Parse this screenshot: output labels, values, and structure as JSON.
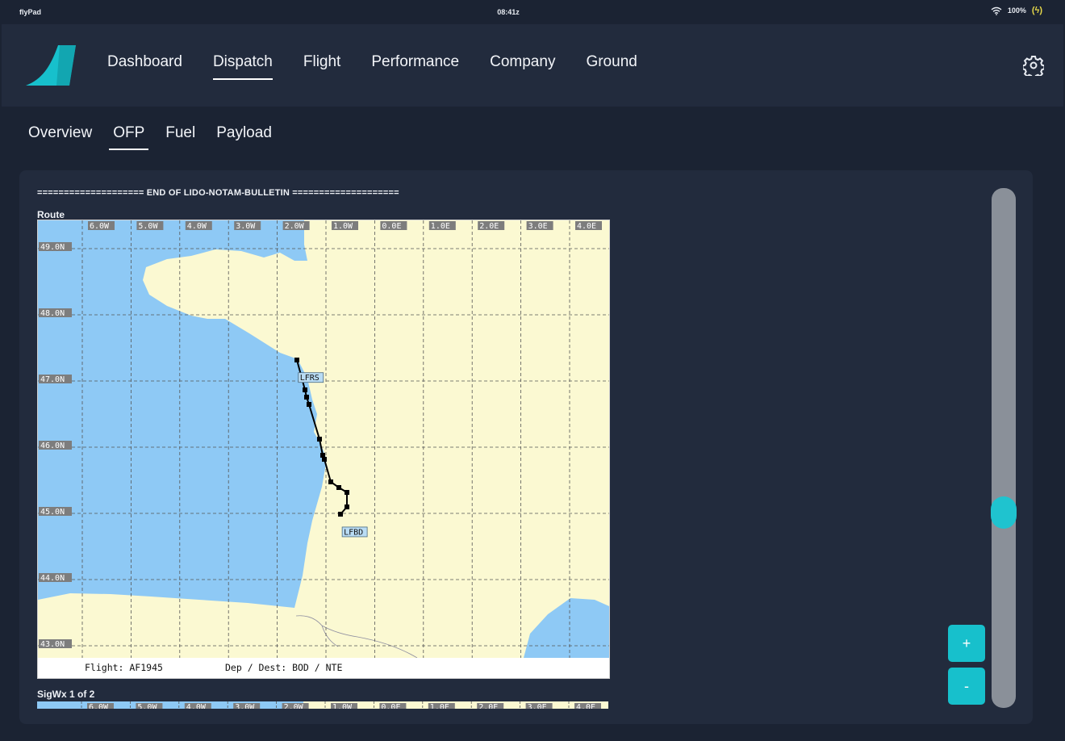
{
  "status_bar": {
    "app_name": "flyPad",
    "time": "08:41z",
    "battery": "100%"
  },
  "nav": {
    "tabs": [
      "Dashboard",
      "Dispatch",
      "Flight",
      "Performance",
      "Company",
      "Ground"
    ],
    "active": "Dispatch"
  },
  "subnav": {
    "tabs": [
      "Overview",
      "OFP",
      "Fuel",
      "Payload"
    ],
    "active": "OFP"
  },
  "ofp": {
    "bulletin_end": "==================== END OF LIDO-NOTAM-BULLETIN ====================",
    "route_title": "Route",
    "sigwx_title": "SigWx 1 of 2",
    "map": {
      "lon_labels": [
        "6.0W",
        "5.0W",
        "4.0W",
        "3.0W",
        "2.0W",
        "1.0W",
        "0.0E",
        "1.0E",
        "2.0E",
        "3.0E",
        "4.0E"
      ],
      "lat_labels": [
        "49.0N",
        "48.0N",
        "47.0N",
        "46.0N",
        "45.0N",
        "44.0N",
        "43.0N"
      ],
      "waypoints": [
        {
          "label": "LFRS",
          "lon": -1.6,
          "lat": 47.15
        },
        {
          "label": "LFBD",
          "lon": -0.7,
          "lat": 44.83
        }
      ],
      "caption": {
        "flight": "Flight: AF1945",
        "dep_dest": "Dep / Dest: BOD / NTE"
      },
      "colors": {
        "sea": "#8ec9f5",
        "land": "#fbf9d2",
        "route": "#000000",
        "label_bg": "#b9dcf4"
      }
    }
  },
  "controls": {
    "zoom_in": "+",
    "zoom_out": "-"
  },
  "accent_color": "#17c0cc"
}
